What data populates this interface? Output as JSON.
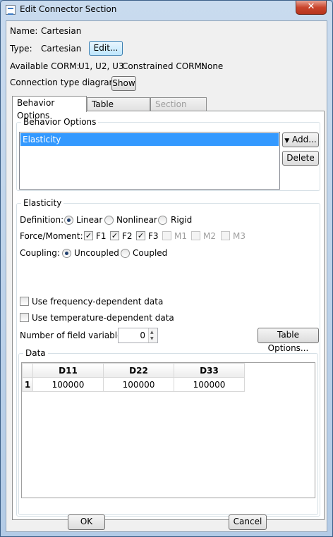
{
  "window": {
    "title": "Edit Connector Section",
    "close_symbol": "✕"
  },
  "info": {
    "name_label": "Name:",
    "name_value": "Cartesian",
    "type_label": "Type:",
    "type_value": "Cartesian",
    "edit_button": "Edit...",
    "available_corm_label": "Available CORM:",
    "available_corm_value": "U1, U2, U3",
    "constrained_corm_label": "Constrained CORM:",
    "constrained_corm_value": "None",
    "diagram_label": "Connection type diagram:",
    "show_button": "Show"
  },
  "tabs": [
    {
      "label": "Behavior Options",
      "active": true,
      "enabled": true
    },
    {
      "label": "Table Options",
      "active": false,
      "enabled": true
    },
    {
      "label": "Section Data",
      "active": false,
      "enabled": false
    }
  ],
  "behavior_options": {
    "group_title": "Behavior Options",
    "items": [
      "Elasticity"
    ],
    "selected": "Elasticity",
    "add_button": "Add...",
    "delete_button": "Delete"
  },
  "elasticity": {
    "group_title": "Elasticity",
    "definition_label": "Definition:",
    "definition_options": [
      "Linear",
      "Nonlinear",
      "Rigid"
    ],
    "definition_selected": "Linear",
    "force_moment_label": "Force/Moment:",
    "components": [
      {
        "label": "F1",
        "checked": true,
        "enabled": true
      },
      {
        "label": "F2",
        "checked": true,
        "enabled": true
      },
      {
        "label": "F3",
        "checked": true,
        "enabled": true
      },
      {
        "label": "M1",
        "checked": false,
        "enabled": false
      },
      {
        "label": "M2",
        "checked": false,
        "enabled": false
      },
      {
        "label": "M3",
        "checked": false,
        "enabled": false
      }
    ],
    "coupling_label": "Coupling:",
    "coupling_options": [
      "Uncoupled",
      "Coupled"
    ],
    "coupling_selected": "Uncoupled",
    "use_frequency_label": "Use frequency-dependent data",
    "use_frequency_checked": false,
    "use_temperature_label": "Use temperature-dependent data",
    "use_temperature_checked": false,
    "field_variables_label": "Number of field variables:",
    "field_variables_value": "0",
    "table_options_button": "Table Options..."
  },
  "data_table": {
    "group_title": "Data",
    "columns": [
      "D11",
      "D22",
      "D33"
    ],
    "rows": [
      {
        "index": "1",
        "values": [
          "100000",
          "100000",
          "100000"
        ]
      }
    ]
  },
  "footer": {
    "ok_button": "OK",
    "cancel_button": "Cancel"
  },
  "colors": {
    "selection": "#3399ff",
    "close_button": "#c9452d",
    "frame": "#b3cbe6"
  }
}
